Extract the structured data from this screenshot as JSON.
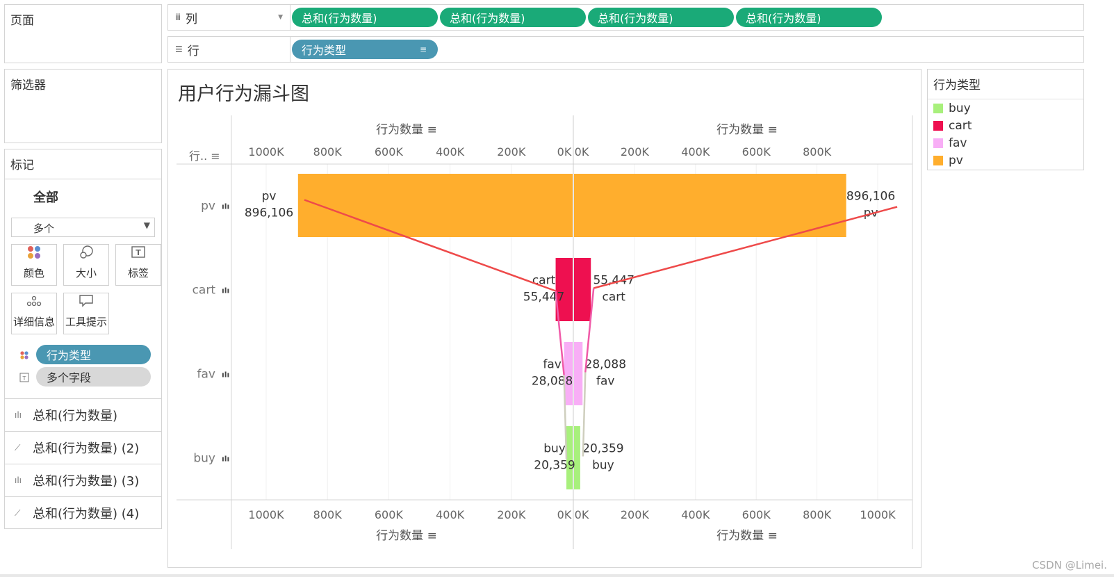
{
  "pages": {
    "title": "页面"
  },
  "filters": {
    "title": "筛选器"
  },
  "columns": {
    "label": "列",
    "pills": [
      "总和(行为数量)",
      "总和(行为数量)",
      "总和(行为数量)",
      "总和(行为数量)"
    ]
  },
  "rows": {
    "label": "行",
    "pill": "行为类型"
  },
  "marks": {
    "title": "标记",
    "all_label": "全部",
    "type_select": "多个",
    "buttons": {
      "color": "颜色",
      "size": "大小",
      "label": "标签",
      "detail": "详细信息",
      "tooltip": "工具提示"
    },
    "color_field": "行为类型",
    "label_field": "多个字段",
    "measures": [
      "总和(行为数量)",
      "总和(行为数量) (2)",
      "总和(行为数量) (3)",
      "总和(行为数量) (4)"
    ]
  },
  "legend": {
    "title": "行为类型",
    "items": [
      {
        "name": "buy",
        "color": "#a8f07c"
      },
      {
        "name": "cart",
        "color": "#ee1050"
      },
      {
        "name": "fav",
        "color": "#f8aef6"
      },
      {
        "name": "pv",
        "color": "#ffae2d"
      }
    ]
  },
  "watermark": "CSDN @Limei.",
  "chart_data": {
    "type": "bar",
    "title": "用户行为漏斗图",
    "row_header": "行..",
    "categories": [
      "pv",
      "cart",
      "fav",
      "buy"
    ],
    "values": [
      896106,
      55447,
      28088,
      20359
    ],
    "value_labels": [
      "896,106",
      "55,447",
      "28,088",
      "20,359"
    ],
    "colors": [
      "#ffae2d",
      "#ee1050",
      "#f8aef6",
      "#a8f07c"
    ],
    "axis_title": "行为数量",
    "left_axis": {
      "reversed": true,
      "range": [
        0,
        1100000
      ],
      "ticks": [
        "1000K",
        "800K",
        "600K",
        "400K",
        "200K",
        "0K"
      ],
      "tick_values": [
        1000000,
        800000,
        600000,
        400000,
        200000,
        0
      ]
    },
    "right_axis": {
      "range": [
        0,
        1050000
      ],
      "ticks_top": [
        "0K",
        "200K",
        "400K",
        "600K",
        "800K"
      ],
      "ticks_bottom": [
        "0K",
        "200K",
        "400K",
        "600K",
        "800K",
        "1000K"
      ],
      "tick_values": [
        0,
        200000,
        400000,
        600000,
        800000,
        1000000
      ]
    },
    "grid": true
  }
}
